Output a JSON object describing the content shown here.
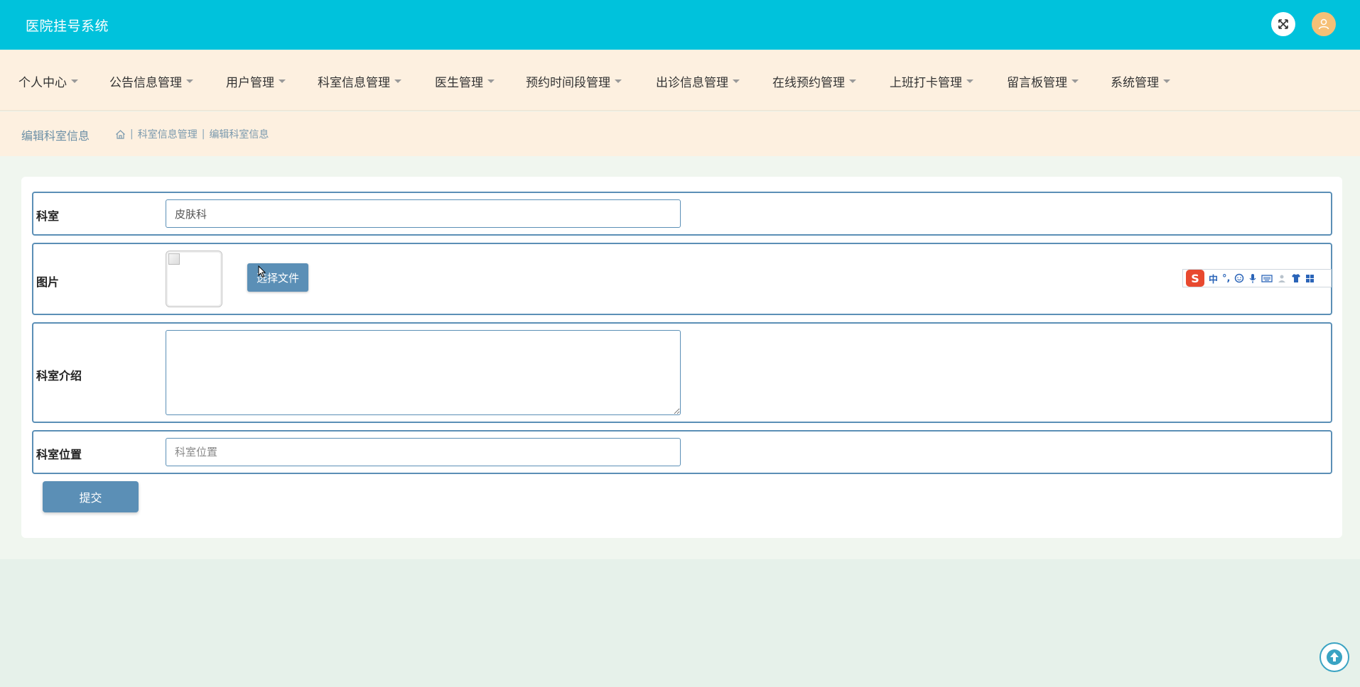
{
  "header": {
    "title": "医院挂号系统",
    "fullscreen_icon": "expand-icon",
    "avatar_icon": "user-icon"
  },
  "nav": {
    "items": [
      {
        "label": "个人中心"
      },
      {
        "label": "公告信息管理"
      },
      {
        "label": "用户管理"
      },
      {
        "label": "科室信息管理"
      },
      {
        "label": "医生管理"
      },
      {
        "label": "预约时间段管理"
      },
      {
        "label": "出诊信息管理"
      },
      {
        "label": "在线预约管理"
      },
      {
        "label": "上班打卡管理"
      },
      {
        "label": "留言板管理"
      },
      {
        "label": "系统管理"
      }
    ]
  },
  "breadcrumb": {
    "page_title": "编辑科室信息",
    "home_icon": "home-icon",
    "items": [
      "科室信息管理",
      "编辑科室信息"
    ],
    "separator": "|"
  },
  "form": {
    "department": {
      "label": "科室",
      "value": "皮肤科"
    },
    "image": {
      "label": "图片",
      "button_label": "选择文件"
    },
    "intro": {
      "label": "科室介绍",
      "value": ""
    },
    "location": {
      "label": "科室位置",
      "placeholder": "科室位置"
    },
    "submit_label": "提交"
  },
  "ime": {
    "logo": "S",
    "mode": "中",
    "punct": "°,"
  },
  "colors": {
    "header_bg": "#00c2dc",
    "nav_bg": "#fdf0e0",
    "accent": "#5b8fb6",
    "avatar": "#f6c077"
  }
}
